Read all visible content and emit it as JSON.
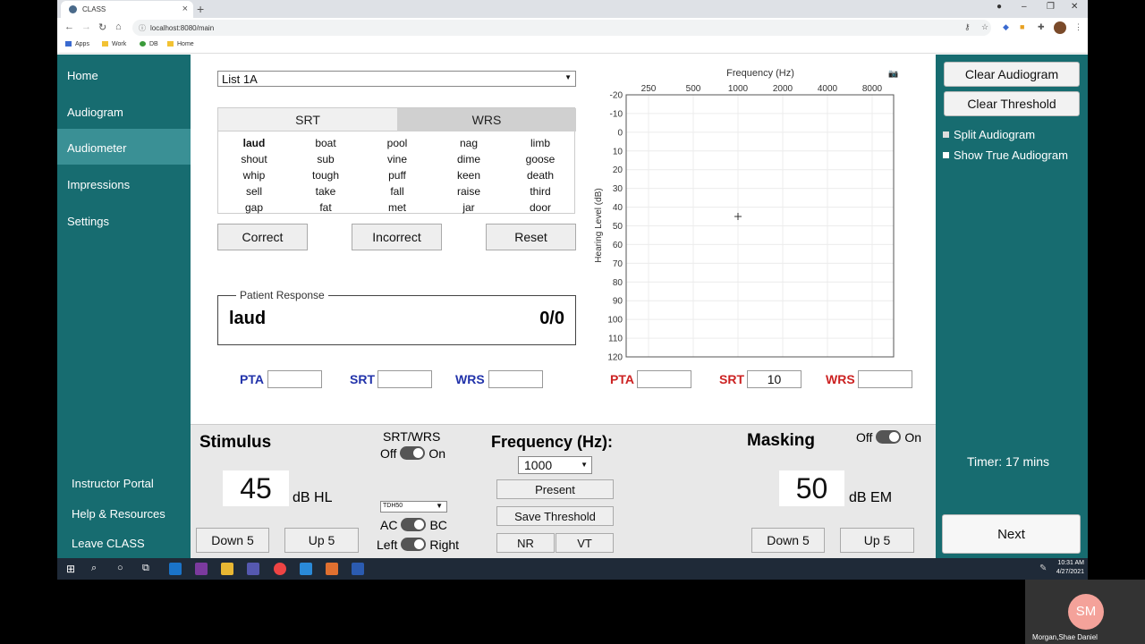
{
  "browser": {
    "tab_title": "CLASS",
    "url": "localhost:8080/main",
    "bookmarks": [
      "Apps",
      "Work",
      "DB",
      "Home"
    ]
  },
  "sidebar": {
    "items": [
      {
        "label": "Home"
      },
      {
        "label": "Audiogram"
      },
      {
        "label": "Audiometer"
      },
      {
        "label": "Impressions"
      },
      {
        "label": "Settings"
      }
    ],
    "bottom_items": [
      {
        "label": "Instructor Portal"
      },
      {
        "label": "Help & Resources"
      },
      {
        "label": "Leave CLASS"
      }
    ]
  },
  "word_list": {
    "selected": "List 1A",
    "tabs": [
      "SRT",
      "WRS"
    ],
    "words": [
      [
        "laud",
        "boat",
        "pool",
        "nag",
        "limb"
      ],
      [
        "shout",
        "sub",
        "vine",
        "dime",
        "goose"
      ],
      [
        "whip",
        "tough",
        "puff",
        "keen",
        "death"
      ],
      [
        "sell",
        "take",
        "fall",
        "raise",
        "third"
      ],
      [
        "gap",
        "fat",
        "met",
        "jar",
        "door"
      ]
    ],
    "buttons": {
      "correct": "Correct",
      "incorrect": "Incorrect",
      "reset": "Reset"
    }
  },
  "response": {
    "legend": "Patient Response",
    "word": "laud",
    "score": "0/0"
  },
  "scores_left": {
    "pta_label": "PTA",
    "srt_label": "SRT",
    "wrs_label": "WRS",
    "pta": "",
    "srt": "",
    "wrs": ""
  },
  "scores_right": {
    "pta_label": "PTA",
    "srt_label": "SRT",
    "wrs_label": "WRS",
    "pta": "",
    "srt": "10",
    "wrs": ""
  },
  "chart_data": {
    "type": "scatter",
    "title": "Frequency (Hz)",
    "ylabel": "Hearing Level (dB)",
    "x_ticks": [
      "250",
      "500",
      "1000",
      "2000",
      "4000",
      "8000"
    ],
    "y_ticks": [
      -20,
      -10,
      0,
      10,
      20,
      30,
      40,
      50,
      60,
      70,
      80,
      90,
      100,
      110,
      120
    ],
    "ylim": [
      -20,
      120
    ],
    "x_axis_position": "top",
    "y_inverted": true,
    "grid": true,
    "cursor": {
      "x": "1000",
      "y": 45
    }
  },
  "stimulus": {
    "title": "Stimulus",
    "value": "45",
    "unit": "dB HL",
    "down": "Down 5",
    "up": "Up 5"
  },
  "srt_wrs": {
    "title": "SRT/WRS",
    "off": "Off",
    "on": "On"
  },
  "transducer": {
    "selected": "TDH50",
    "ac": "AC",
    "bc": "BC",
    "left": "Left",
    "right": "Right"
  },
  "frequency": {
    "title": "Frequency (Hz):",
    "selected": "1000",
    "present": "Present",
    "save": "Save Threshold",
    "nr": "NR",
    "vt": "VT"
  },
  "masking": {
    "title": "Masking",
    "off": "Off",
    "on": "On",
    "value": "50",
    "unit": "dB EM",
    "down": "Down 5",
    "up": "Up 5"
  },
  "right_panel": {
    "clear_audiogram": "Clear Audiogram",
    "clear_threshold": "Clear Threshold",
    "split_audiogram": "Split Audiogram",
    "show_true": "Show True Audiogram",
    "timer": "Timer: 17 mins",
    "next": "Next"
  },
  "taskbar": {
    "time": "10:31 AM",
    "date": "4/27/2021"
  },
  "camera": {
    "initials": "SM",
    "name": "Morgan,Shae Daniel"
  }
}
